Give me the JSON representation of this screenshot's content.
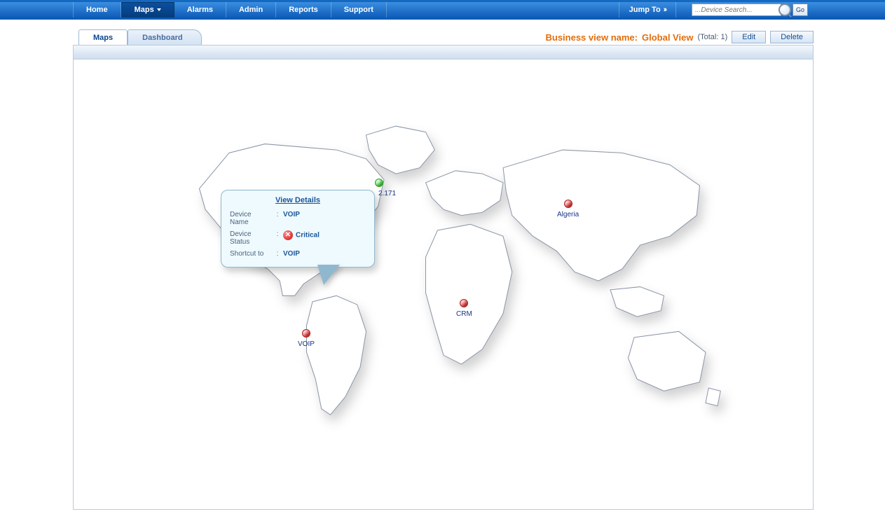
{
  "nav": {
    "items": [
      {
        "label": "Home"
      },
      {
        "label": "Maps",
        "active": true,
        "dropdown": true
      },
      {
        "label": "Alarms"
      },
      {
        "label": "Admin"
      },
      {
        "label": "Reports"
      },
      {
        "label": "Support"
      }
    ],
    "jump_to": "Jump To",
    "search_placeholder": "...Device Search...",
    "go": "Go"
  },
  "tabs": {
    "maps": "Maps",
    "dashboard": "Dashboard"
  },
  "business_view": {
    "label": "Business view name:",
    "name": "Global View",
    "total_label": "(Total: 1)",
    "edit": "Edit",
    "delete": "Delete"
  },
  "tooltip": {
    "title": "View Details",
    "rows": {
      "device_name": {
        "k": "Device Name",
        "v": "VOIP"
      },
      "device_status": {
        "k": "Device Status",
        "v": "Critical"
      },
      "shortcut_to": {
        "k": "Shortcut to",
        "v": "VOIP"
      }
    }
  },
  "nodes": {
    "n1": {
      "label": "2.171"
    },
    "voip": {
      "label": "VOIP"
    },
    "crm": {
      "label": "CRM"
    },
    "algeria": {
      "label": "Algeria"
    }
  }
}
